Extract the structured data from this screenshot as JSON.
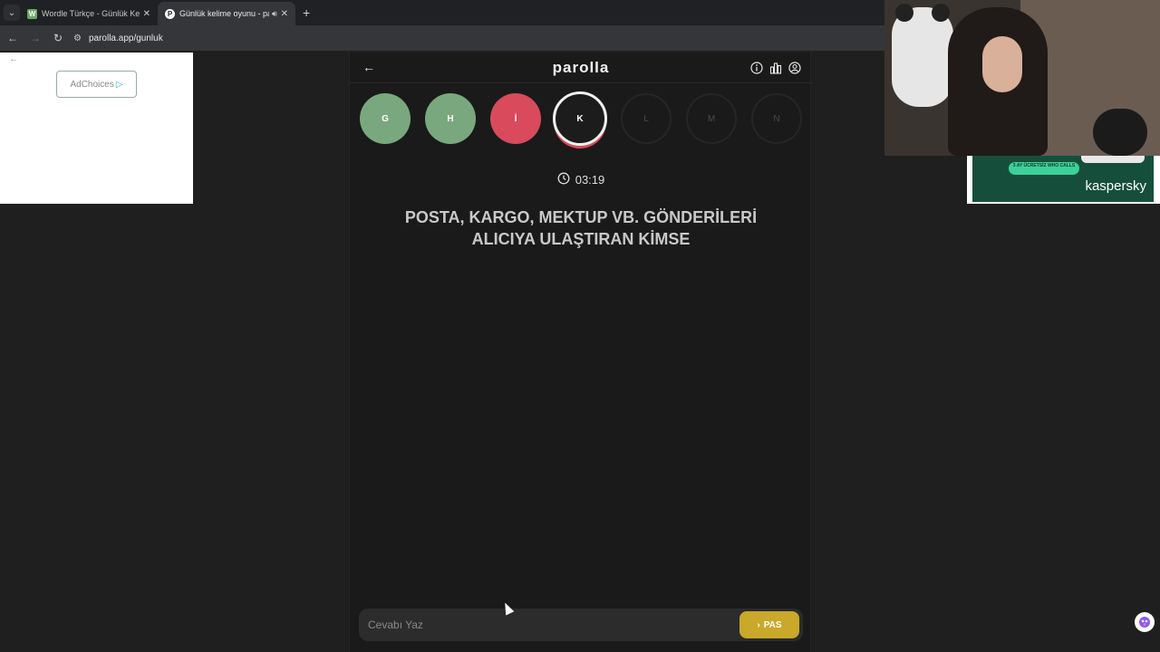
{
  "browser": {
    "tabs": [
      {
        "title": "Wordle Türkçe - Günlük Kelime",
        "favicon_letter": "W",
        "favicon_color": "#6aaa64",
        "active": false
      },
      {
        "title": "Günlük kelime oyunu - parolla",
        "favicon_letter": "P",
        "favicon_color": "#ffffff",
        "active": true
      }
    ],
    "new_tab": "+",
    "url": "parolla.app/gunluk"
  },
  "ad": {
    "adchoices_label": "AdChoices"
  },
  "game": {
    "logo": "parolla",
    "letters": [
      {
        "letter": "G",
        "state": "correct"
      },
      {
        "letter": "H",
        "state": "correct"
      },
      {
        "letter": "İ",
        "state": "wrong"
      },
      {
        "letter": "K",
        "state": "current"
      },
      {
        "letter": "L",
        "state": "pending"
      },
      {
        "letter": "M",
        "state": "pending"
      },
      {
        "letter": "N",
        "state": "pending"
      }
    ],
    "timer": "03:19",
    "question": "POSTA, KARGO, MEKTUP VB. GÖNDERİLERİ ALICIYA ULAŞTIRAN KİMSE",
    "answer_placeholder": "Cevabı Yaz",
    "pass_label": "PAS",
    "colors": {
      "correct": "#7aa87e",
      "wrong": "#d84a5c",
      "pass_button": "#c9a82a"
    }
  },
  "sponsor": {
    "badge": "3 AY ÜCRETSİZ WHO CALLS",
    "brand": "kaspersky"
  }
}
